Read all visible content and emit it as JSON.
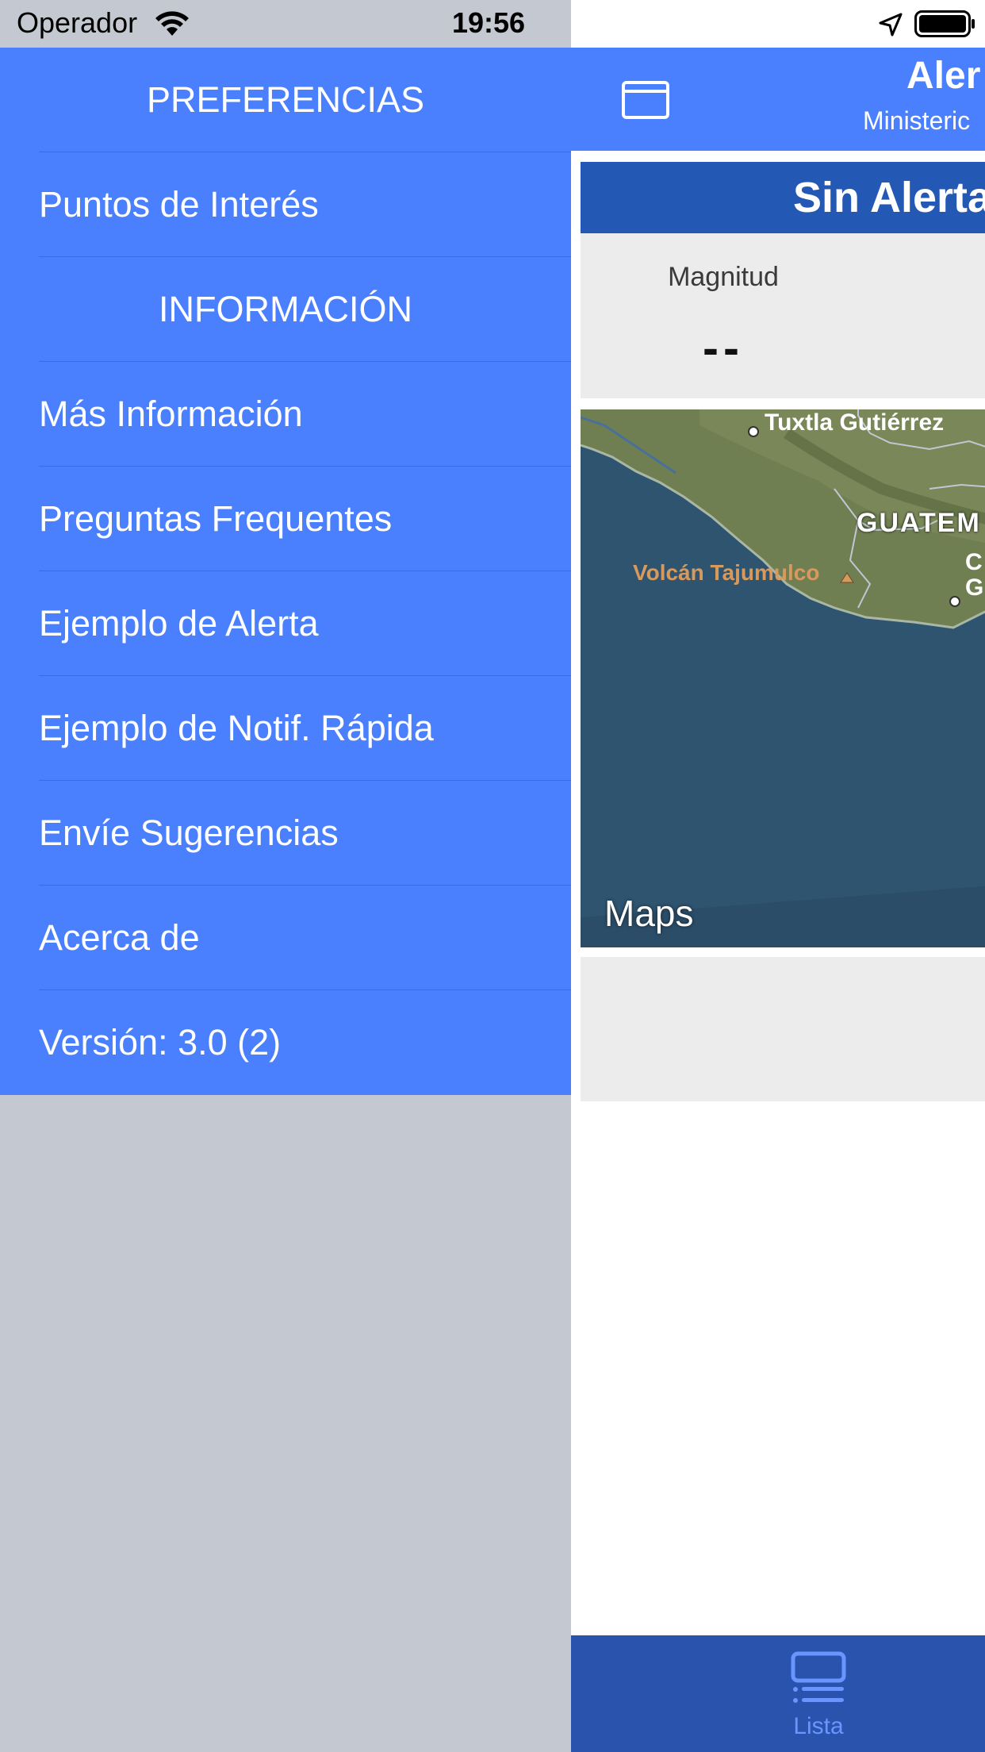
{
  "status_bar": {
    "carrier": "Operador",
    "time": "19:56",
    "icons": [
      "wifi-icon",
      "location-icon",
      "battery-icon"
    ]
  },
  "menu": {
    "sections": [
      {
        "title": "PREFERENCIAS",
        "items": [
          "Puntos de Interés"
        ]
      },
      {
        "title": "INFORMACIÓN",
        "items": [
          "Más Información",
          "Preguntas Frequentes",
          "Ejemplo de Alerta",
          "Ejemplo de Notif. Rápida",
          "Envíe Sugerencias",
          "Acerca de",
          "Versión: 3.0 (2)"
        ]
      }
    ]
  },
  "navbar": {
    "title": "Aler",
    "subtitle": "Ministeric",
    "toggle_icon": "sidebar-toggle-icon"
  },
  "alert": {
    "title": "Sin Alerta",
    "magnitude_label": "Magnitud",
    "magnitude_value": "--"
  },
  "map": {
    "labels": {
      "city_1": "Tuxtla Gutiérrez",
      "country": "GUATEM",
      "volcano": "Volcán Tajumulco",
      "city_2_a": "C",
      "city_2_b": "G"
    },
    "attribution": "Maps"
  },
  "tabbar": {
    "tabs": [
      {
        "label": "Lista",
        "icon": "list-icon"
      }
    ]
  },
  "colors": {
    "menu_bg": "#4a7ffd",
    "alert_header": "#2359b4",
    "tabbar_bg": "#2a53ad",
    "tab_active": "#6a95ff"
  }
}
